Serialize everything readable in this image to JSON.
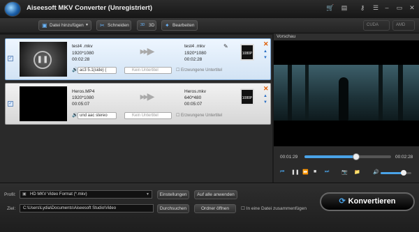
{
  "app": {
    "title": "Aiseesoft MKV Converter (Unregistriert)",
    "title_icons": [
      "cart-icon",
      "film-icon",
      "key-icon",
      "menu-icon",
      "minimize-icon",
      "restore-icon",
      "close-icon"
    ]
  },
  "toolbar": {
    "add_file": "Datei hinzufügen",
    "cut": "Schneiden",
    "three_d": "3D",
    "edit": "Bearbeiten",
    "cuda": "CUDA",
    "amd": "AMD"
  },
  "files": [
    {
      "src_name": "test4 .mkv",
      "src_res": "1920*1080",
      "src_dur": "00:02:28",
      "dst_name": "test4 .mkv",
      "dst_res": "1920*1080",
      "dst_dur": "00:02:28",
      "audio": "ac3 5.1(side) (",
      "subtitle": "Kein Untertitel",
      "forced": "Erzwungene Untertitel",
      "format_badge": "1080P",
      "selected": true
    },
    {
      "src_name": "Heros.MP4",
      "src_res": "1920*1080",
      "src_dur": "00:05:07",
      "dst_name": "Heros.mkv",
      "dst_res": "640*480",
      "dst_dur": "00:05:07",
      "audio": "und aac stereo",
      "subtitle": "Kein Untertitel",
      "forced": "Erzwungene Untertitel",
      "format_badge": "1080P",
      "selected": false
    }
  ],
  "preview": {
    "label": "Vorschau",
    "time_current": "00:01:29",
    "time_total": "00:02:28",
    "progress": 0.6,
    "volume": 0.75
  },
  "bottom": {
    "profile_label": "Profil:",
    "profile_value": "HD MKV Video Format (*.mkv)",
    "settings": "Einstellungen",
    "apply_all": "Auf alle anwenden",
    "dest_label": "Ziel:",
    "dest_value": "C:\\Users\\Lydia\\Documents\\Aiseesoft Studio\\Video",
    "browse": "Durchsuchen",
    "open_folder": "Ordner öffnen",
    "merge": "In eine Datei zusammenfügen",
    "convert": "Konvertieren"
  },
  "colors": {
    "accent": "#6ab7ff",
    "remove": "#e05a00",
    "card_selected": "#d2e3f4"
  }
}
